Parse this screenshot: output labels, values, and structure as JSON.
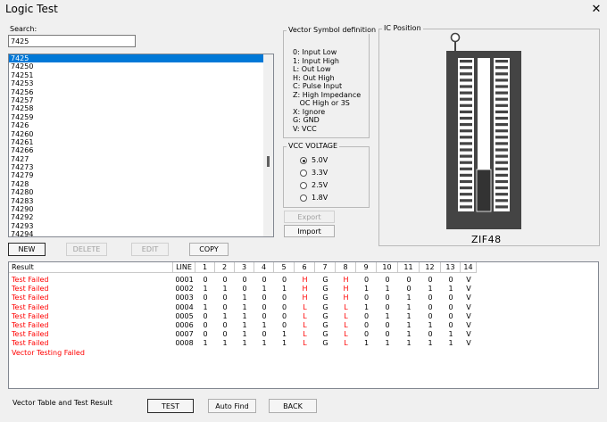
{
  "window": {
    "title": "Logic Test",
    "close_glyph": "✕"
  },
  "search": {
    "label": "Search:",
    "value": "7425"
  },
  "ic_list": [
    "7425",
    "74250",
    "74251",
    "74253",
    "74256",
    "74257",
    "74258",
    "74259",
    "7426",
    "74260",
    "74261",
    "74266",
    "7427",
    "74273",
    "74279",
    "7428",
    "74280",
    "74283",
    "74290",
    "74292",
    "74293",
    "74294"
  ],
  "vector_symbols": {
    "title": "Vector Symbol definition",
    "lines": [
      "0: Input Low",
      "1: Input High",
      "L: Out Low",
      "H: Out High",
      "C: Pulse Input",
      "Z: High Impedance",
      "   OC High or 3S",
      "X: Ignore",
      "G: GND",
      "V: VCC"
    ]
  },
  "vcc": {
    "title": "VCC VOLTAGE",
    "options": [
      "5.0V",
      "3.3V",
      "2.5V",
      "1.8V"
    ],
    "selected": "5.0V"
  },
  "buttons": {
    "export": "Export",
    "import": "Import",
    "new": "NEW",
    "delete": "DELETE",
    "edit": "EDIT",
    "copy": "COPY",
    "test": "TEST",
    "auto_find": "Auto Find",
    "back": "BACK"
  },
  "ic_position": {
    "title": "IC Position",
    "socket_label": "ZIF48"
  },
  "table": {
    "headers": [
      "Result",
      "LINE",
      "1",
      "2",
      "3",
      "4",
      "5",
      "6",
      "7",
      "8",
      "9",
      "10",
      "11",
      "12",
      "13",
      "14"
    ],
    "rows": [
      {
        "result": "Test Failed",
        "line": "0001",
        "cells": [
          "0",
          "0",
          "0",
          "0",
          "0",
          "H",
          "G",
          "H",
          "0",
          "0",
          "0",
          "0",
          "0",
          "V"
        ]
      },
      {
        "result": "Test Failed",
        "line": "0002",
        "cells": [
          "1",
          "1",
          "0",
          "1",
          "1",
          "H",
          "G",
          "H",
          "1",
          "1",
          "0",
          "1",
          "1",
          "V"
        ]
      },
      {
        "result": "Test Failed",
        "line": "0003",
        "cells": [
          "0",
          "0",
          "1",
          "0",
          "0",
          "H",
          "G",
          "H",
          "0",
          "0",
          "1",
          "0",
          "0",
          "V"
        ]
      },
      {
        "result": "Test Failed",
        "line": "0004",
        "cells": [
          "1",
          "0",
          "1",
          "0",
          "0",
          "L",
          "G",
          "L",
          "1",
          "0",
          "1",
          "0",
          "0",
          "V"
        ]
      },
      {
        "result": "Test Failed",
        "line": "0005",
        "cells": [
          "0",
          "1",
          "1",
          "0",
          "0",
          "L",
          "G",
          "L",
          "0",
          "1",
          "1",
          "0",
          "0",
          "V"
        ]
      },
      {
        "result": "Test Failed",
        "line": "0006",
        "cells": [
          "0",
          "0",
          "1",
          "1",
          "0",
          "L",
          "G",
          "L",
          "0",
          "0",
          "1",
          "1",
          "0",
          "V"
        ]
      },
      {
        "result": "Test Failed",
        "line": "0007",
        "cells": [
          "0",
          "0",
          "1",
          "0",
          "1",
          "L",
          "G",
          "L",
          "0",
          "0",
          "1",
          "0",
          "1",
          "V"
        ]
      },
      {
        "result": "Test Failed",
        "line": "0008",
        "cells": [
          "1",
          "1",
          "1",
          "1",
          "1",
          "L",
          "G",
          "L",
          "1",
          "1",
          "1",
          "1",
          "1",
          "V"
        ]
      }
    ],
    "summary": "Vector Testing Failed"
  },
  "status": {
    "caption": "Vector Table and Test Result"
  },
  "colors": {
    "fail": "#ff0000",
    "selection": "#0078d7",
    "ok": "#000000"
  }
}
